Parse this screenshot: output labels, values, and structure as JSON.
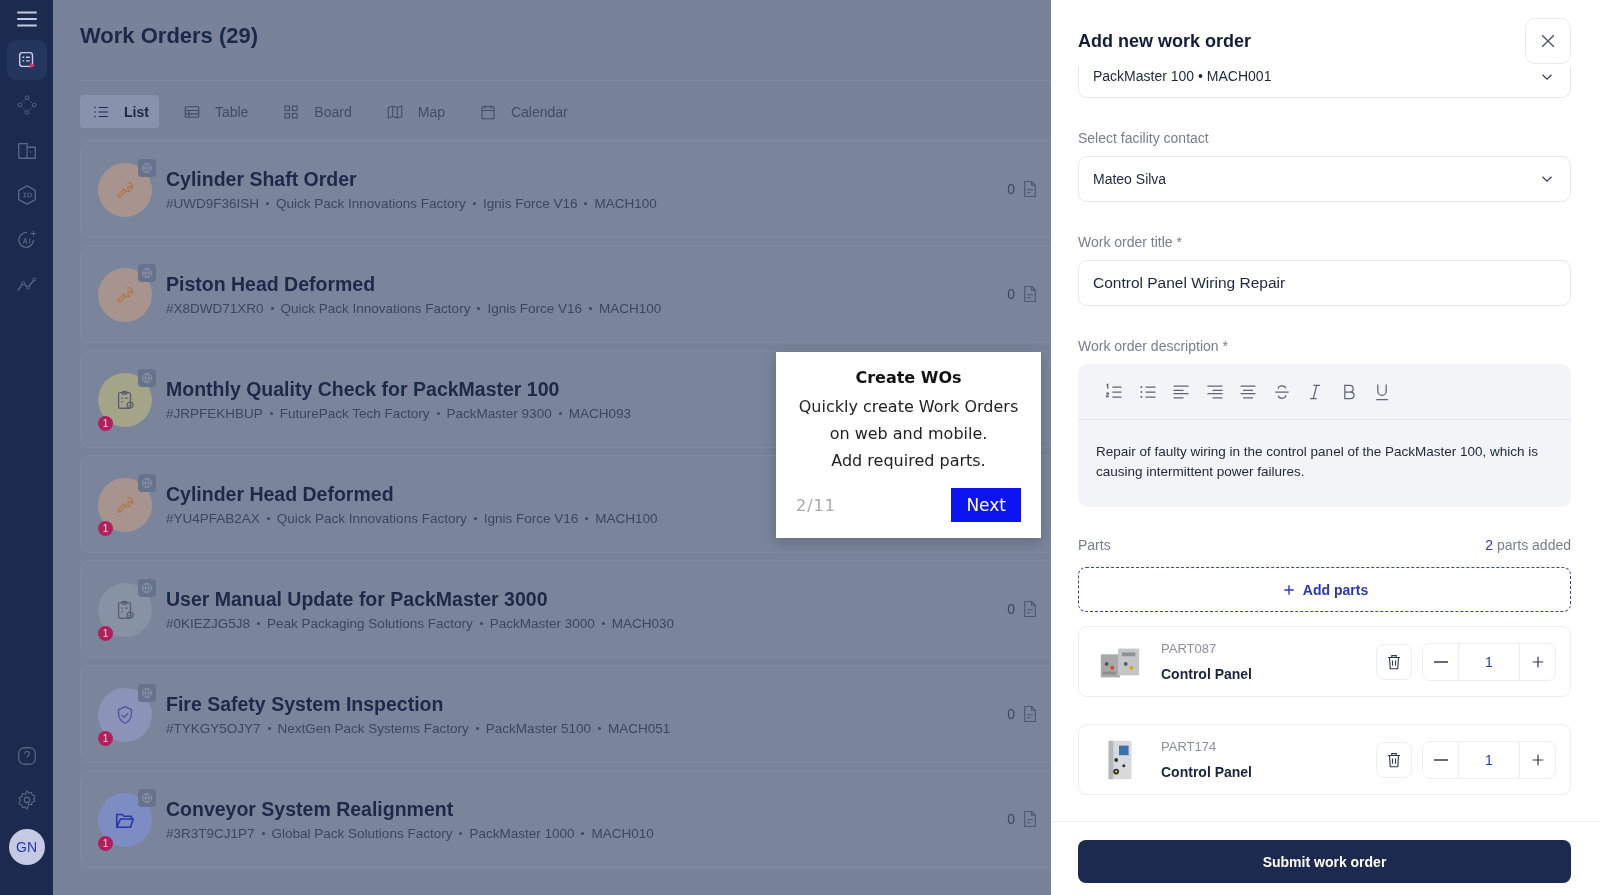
{
  "sidebar": {
    "items": [
      {
        "selected": true
      },
      {
        "selected": false
      },
      {
        "selected": false
      },
      {
        "selected": false
      },
      {
        "selected": false
      },
      {
        "selected": false
      }
    ],
    "avatar": "GN"
  },
  "page": {
    "title": "Work Orders (29)"
  },
  "views": [
    {
      "label": "List",
      "kind": "list",
      "selected": true
    },
    {
      "label": "Table",
      "kind": "table",
      "selected": false
    },
    {
      "label": "Board",
      "kind": "board",
      "selected": false
    },
    {
      "label": "Map",
      "kind": "map",
      "selected": false
    },
    {
      "label": "Calendar",
      "kind": "calendar",
      "selected": false
    }
  ],
  "work_orders": [
    {
      "title": "Cylinder Shaft Order",
      "id": "#UWD9F36ISH",
      "facility": "Quick Pack Innovations Factory",
      "machine": "Ignis Force V16",
      "machine_code": "MACH100",
      "kind": "wrench",
      "color": "#a8948f",
      "attachments": "0"
    },
    {
      "title": "Piston Head Deformed",
      "id": "#X8DWD71XR0",
      "facility": "Quick Pack Innovations Factory",
      "machine": "Ignis Force V16",
      "machine_code": "MACH100",
      "kind": "wrench",
      "color": "#a8948f",
      "attachments": "0"
    },
    {
      "title": "Monthly Quality Check for PackMaster 100",
      "id": "#JRPFEKHBUP",
      "facility": "FuturePack Tech Factory",
      "machine": "PackMaster 9300",
      "machine_code": "MACH093",
      "kind": "clipboard",
      "color": "#a4a489",
      "badge": "1"
    },
    {
      "title": "Cylinder Head Deformed",
      "id": "#YU4PFAB2AX",
      "facility": "Quick Pack Innovations Factory",
      "machine": "Ignis Force V16",
      "machine_code": "MACH100",
      "kind": "wrench",
      "color": "#a8948f",
      "badge": "1"
    },
    {
      "title": "User Manual Update for PackMaster 3000",
      "id": "#0KIEZJG5J8",
      "facility": "Peak Packaging Solutions Factory",
      "machine": "PackMaster 3000",
      "machine_code": "MACH030",
      "kind": "clipboard",
      "color": "#8892a5",
      "badge": "1",
      "attachments": "0"
    },
    {
      "title": "Fire Safety System Inspection",
      "id": "#TYKGY5OJY7",
      "facility": "NextGen Pack Systems Factory",
      "machine": "PackMaster 5100",
      "machine_code": "MACH051",
      "kind": "shield",
      "color": "#8c93b8",
      "badge": "1",
      "attachments": "0"
    },
    {
      "title": "Conveyor System Realignment",
      "id": "#3R3T9CJ1P7",
      "facility": "Global Pack Solutions Factory",
      "machine": "PackMaster 1000",
      "machine_code": "MACH010",
      "kind": "folder",
      "color": "#7e8cc4",
      "badge": "1",
      "attachments": "0"
    }
  ],
  "tour": {
    "title": "Create WOs",
    "body": [
      "Quickly create Work Orders",
      "on web and mobile.",
      "Add required parts."
    ],
    "step": "2/11",
    "next": "Next"
  },
  "drawer": {
    "title": "Add new work order",
    "machine_select": {
      "value": "PackMaster 100 • MACH001"
    },
    "contact": {
      "label": "Select facility contact",
      "value": "Mateo Silva"
    },
    "title_field": {
      "label": "Work order title *",
      "value": "Control Panel Wiring Repair"
    },
    "description": {
      "label": "Work order description *",
      "text": "Repair of faulty wiring in the control panel of the PackMaster 100, which is causing intermittent power failures."
    },
    "parts": {
      "label": "Parts",
      "count": "2",
      "count_suffix": "parts added",
      "add": "Add parts",
      "items": [
        {
          "code": "PART087",
          "name": "Control Panel",
          "quantity": "1"
        },
        {
          "code": "PART174",
          "name": "Control Panel",
          "quantity": "1"
        }
      ]
    },
    "submit": "Submit work order"
  }
}
